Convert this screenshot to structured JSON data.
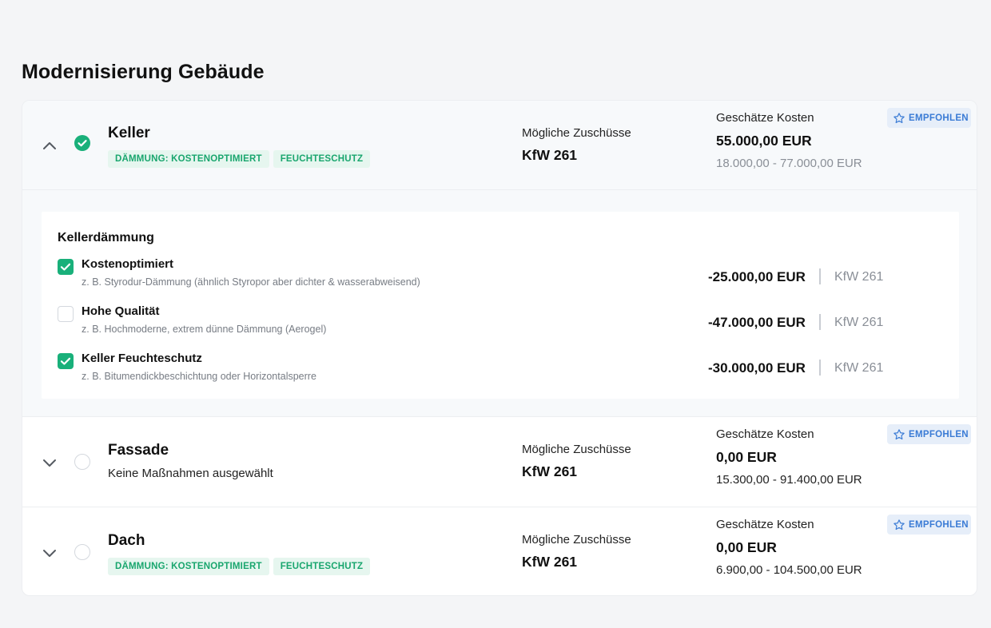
{
  "page_title": "Modernisierung Gebäude",
  "colors": {
    "accent_green": "#19b07a",
    "tag_text": "#19a66e",
    "badge_blue": "#3a7bd5"
  },
  "rows": {
    "keller": {
      "title": "Keller",
      "expanded": true,
      "selected": true,
      "tags": [
        "DÄMMUNG: KOSTENOPTIMIERT",
        "FEUCHTESCHUTZ"
      ],
      "zuschuss_label": "Mögliche Zuschüsse",
      "zuschuss_value": "KfW 261",
      "cost_label": "Geschätze Kosten",
      "cost_value": "55.000,00 EUR",
      "cost_range": "18.000,00 - 77.000,00 EUR",
      "badge": "EMPFOHLEN"
    },
    "fassade": {
      "title": "Fassade",
      "subtitle": "Keine Maßnahmen ausgewählt",
      "expanded": false,
      "selected": false,
      "zuschuss_label": "Mögliche Zuschüsse",
      "zuschuss_value": "KfW 261",
      "cost_label": "Geschätze Kosten",
      "cost_value": "0,00 EUR",
      "cost_range": "15.300,00 - 91.400,00 EUR",
      "badge": "EMPFOHLEN"
    },
    "dach": {
      "title": "Dach",
      "expanded": false,
      "selected": false,
      "tags": [
        "DÄMMUNG: KOSTENOPTIMIERT",
        "FEUCHTESCHUTZ"
      ],
      "zuschuss_label": "Mögliche Zuschüsse",
      "zuschuss_value": "KfW 261",
      "cost_label": "Geschätze Kosten",
      "cost_value": "0,00 EUR",
      "cost_range": "6.900,00 - 104.500,00 EUR",
      "badge": "EMPFOHLEN"
    }
  },
  "keller_panel": {
    "title": "Kellerdämmung",
    "options": [
      {
        "label": "Kostenoptimiert",
        "desc": "z. B. Styrodur-Dämmung (ähnlich Styropor aber dichter & wasserabweisend)",
        "amount": "-25.000,00 EUR",
        "kfw": "KfW 261",
        "checked": true
      },
      {
        "label": "Hohe Qualität",
        "desc": "z. B. Hochmoderne, extrem dünne Dämmung (Aerogel)",
        "amount": "-47.000,00 EUR",
        "kfw": "KfW 261",
        "checked": false
      },
      {
        "label": "Keller Feuchteschutz",
        "desc": "z. B. Bitumendickbeschichtung oder Horizontalsperre",
        "amount": "-30.000,00 EUR",
        "kfw": "KfW 261",
        "checked": true
      }
    ]
  }
}
